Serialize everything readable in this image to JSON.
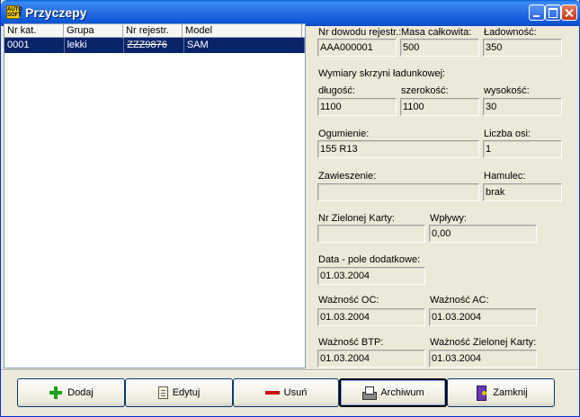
{
  "window": {
    "title": "Przyczepy",
    "app_icon_text": "AUTO SOFT"
  },
  "list": {
    "columns": [
      "Nr kat.",
      "Grupa",
      "Nr rejestr.",
      "Model"
    ],
    "rows": [
      {
        "nr_kat": "0001",
        "grupa": "lekki",
        "nr_rejestr": "ZZZ9876",
        "model": "SAM"
      }
    ]
  },
  "details": {
    "nr_dowodu": {
      "label": "Nr dowodu rejestr.:",
      "value": "AAA000001"
    },
    "masa": {
      "label": "Masa całkowita:",
      "value": "500"
    },
    "ladownosc": {
      "label": "Ładowność:",
      "value": "350"
    },
    "wymiary_label": "Wymiary skrzyni ładunkowej:",
    "dlugosc": {
      "label": "długość:",
      "value": "1100"
    },
    "szerokosc": {
      "label": "szerokość:",
      "value": "1100"
    },
    "wysokosc": {
      "label": "wysokość:",
      "value": "30"
    },
    "ogumienie": {
      "label": "Ogumienie:",
      "value": "155 R13"
    },
    "liczba_osi": {
      "label": "Liczba osi:",
      "value": "1"
    },
    "zawieszenie": {
      "label": "Zawieszenie:",
      "value": ""
    },
    "hamulec": {
      "label": "Hamulec:",
      "value": "brak"
    },
    "nr_zielonej_karty": {
      "label": "Nr Zielonej Karty:",
      "value": ""
    },
    "wplywy": {
      "label": "Wpływy:",
      "value": "0,00"
    },
    "data_pole": {
      "label": "Data - pole dodatkowe:",
      "value": "01.03.2004"
    },
    "waznosc_oc": {
      "label": "Ważność OC:",
      "value": "01.03.2004"
    },
    "waznosc_ac": {
      "label": "Ważność AC:",
      "value": "01.03.2004"
    },
    "waznosc_btp": {
      "label": "Ważność BTP:",
      "value": "01.03.2004"
    },
    "waznosc_zielonej_karty": {
      "label": "Ważność Zielonej Karty:",
      "value": "01.03.2004"
    }
  },
  "toolbar": {
    "add_label": "Dodaj",
    "edit_label": "Edytuj",
    "delete_label": "Usuń",
    "archive_label": "Archiwum",
    "close_label": "Zamknij"
  }
}
